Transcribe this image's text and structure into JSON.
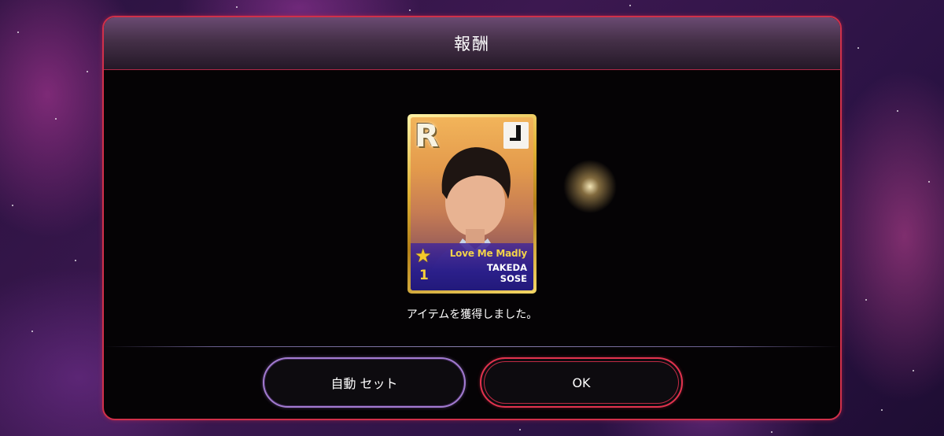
{
  "dialog": {
    "title": "報酬",
    "message": "アイテムを獲得しました。"
  },
  "card": {
    "rarity": "R",
    "level": "1",
    "song_title": "Love Me Madly",
    "member_name": "TAKEDA SOSE",
    "star_icon": "star-icon",
    "brand_icon": "group-logo-icon"
  },
  "buttons": {
    "auto_set": "自動 セット",
    "ok": "OK"
  },
  "colors": {
    "dialog_border": "#d0304a",
    "auto_button_border": "#a27bd0",
    "ok_button_border": "#e2334e",
    "card_gold": "#e2b336",
    "card_footer": "#2b1f8a"
  }
}
